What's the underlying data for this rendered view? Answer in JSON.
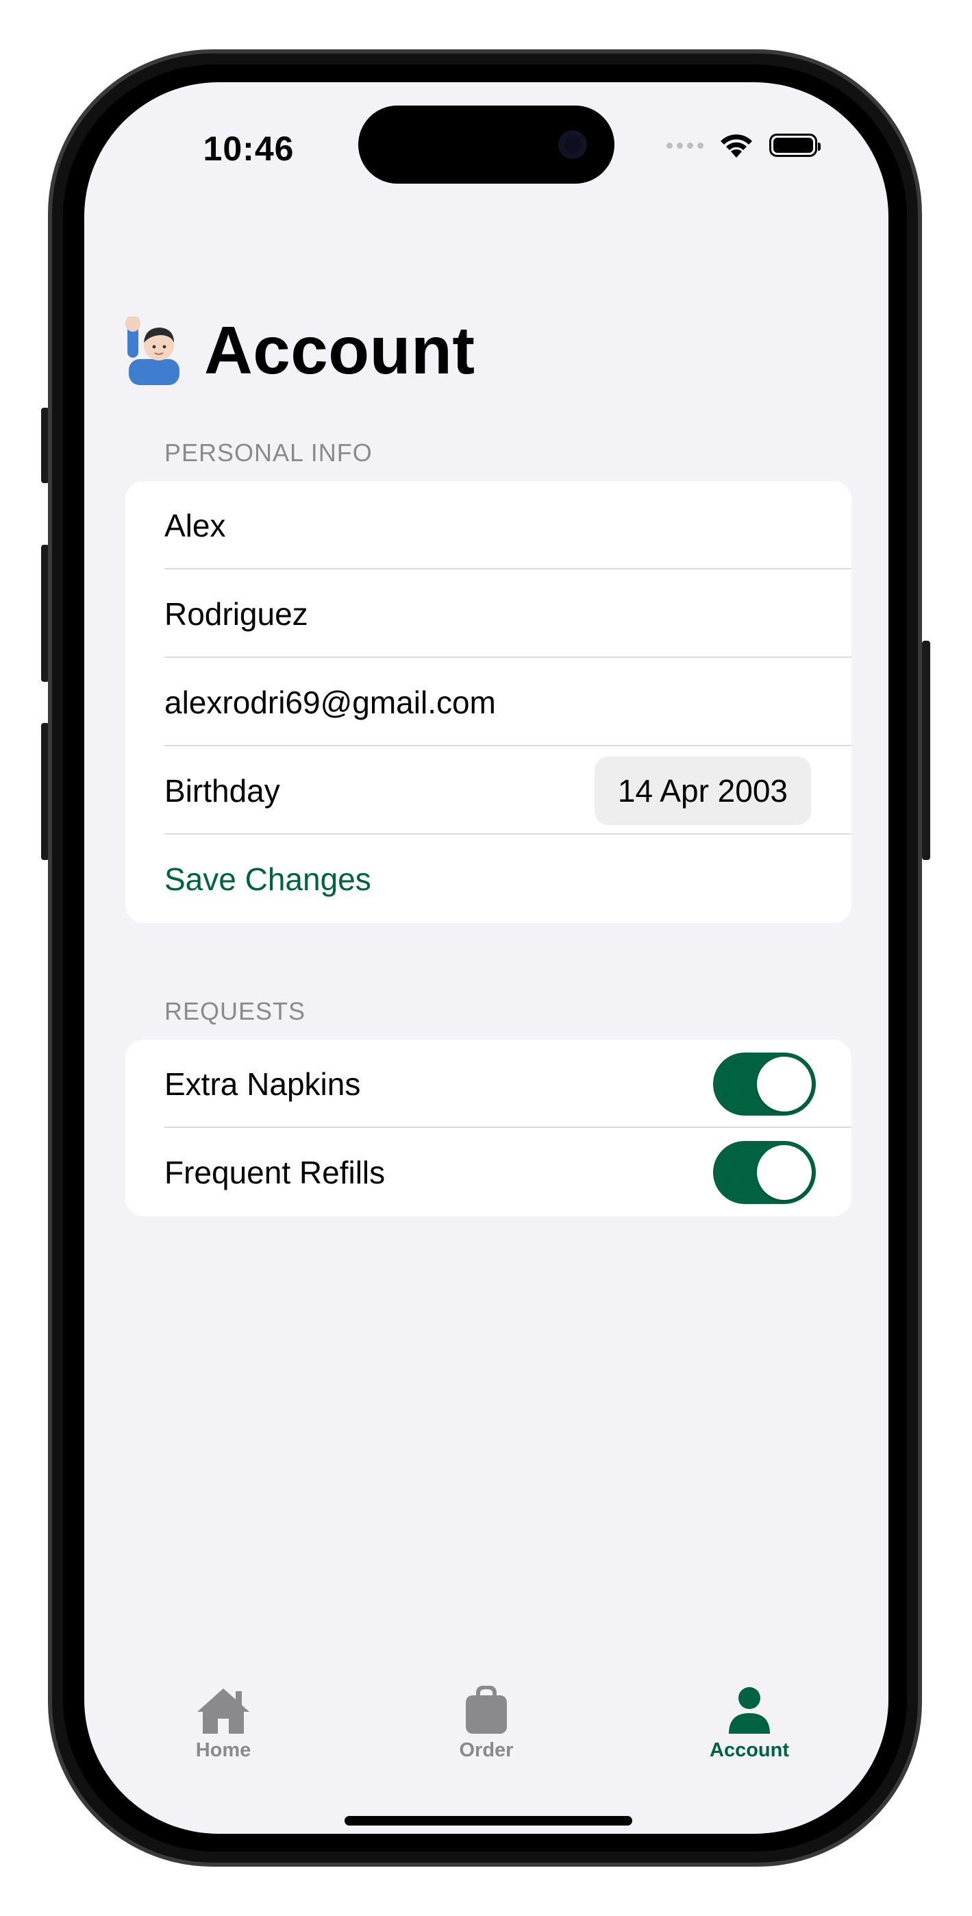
{
  "status_bar": {
    "time": "10:46"
  },
  "page": {
    "title": "Account",
    "title_icon": "person-raising-hand-emoji"
  },
  "personal_info": {
    "header": "PERSONAL INFO",
    "first_name": "Alex",
    "last_name": "Rodriguez",
    "email": "alexrodri69@gmail.com",
    "birthday_label": "Birthday",
    "birthday_value": "14 Apr 2003",
    "save_label": "Save Changes"
  },
  "requests": {
    "header": "REQUESTS",
    "items": [
      {
        "label": "Extra Napkins",
        "enabled": true
      },
      {
        "label": "Frequent Refills",
        "enabled": true
      }
    ]
  },
  "tabs": [
    {
      "label": "Home",
      "icon": "house-icon",
      "active": false
    },
    {
      "label": "Order",
      "icon": "bag-icon",
      "active": false
    },
    {
      "label": "Account",
      "icon": "person-icon",
      "active": true
    }
  ],
  "colors": {
    "accent": "#006241",
    "background": "#f2f2f7",
    "secondary_text": "#8a8a8e"
  }
}
